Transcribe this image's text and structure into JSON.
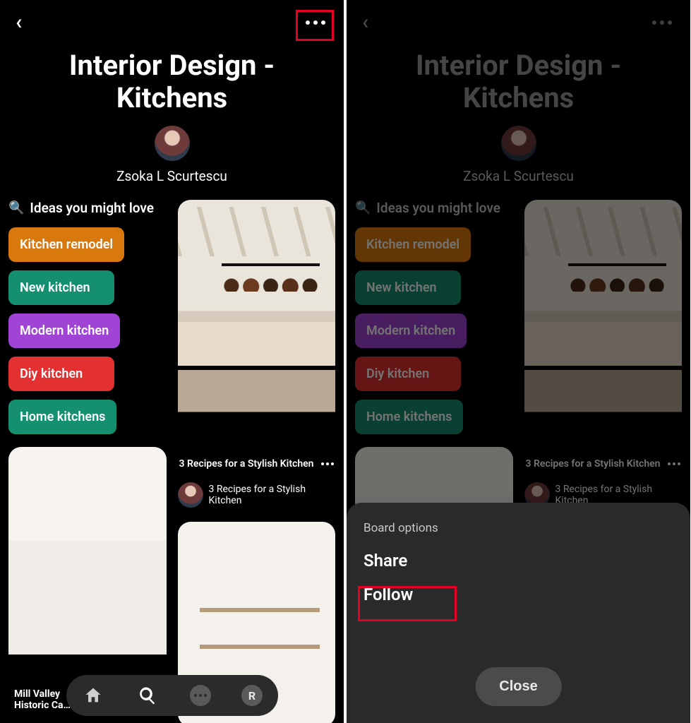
{
  "board": {
    "title": "Interior Design - Kitchens",
    "author": "Zsoka L Scurtescu"
  },
  "ideas": {
    "heading": "Ideas you might love",
    "chips": [
      {
        "label": "Kitchen remodel",
        "color": "#d9780d"
      },
      {
        "label": "New kitchen",
        "color": "#148f6f"
      },
      {
        "label": "Modern kitchen",
        "color": "#a044d6"
      },
      {
        "label": "Diy kitchen",
        "color": "#e33030"
      },
      {
        "label": "Home kitchens",
        "color": "#148f6f"
      }
    ]
  },
  "pins": {
    "p1": {
      "caption": "3 Recipes for a Stylish Kitchen",
      "desc": "3 Recipes for a Stylish Kitchen"
    },
    "p2": {
      "caption_line1": "Mill Valley",
      "caption_line2": "Historic Ca…"
    }
  },
  "sheet": {
    "label": "Board options",
    "option_share": "Share",
    "option_follow": "Follow",
    "close": "Close"
  },
  "nav": {
    "profile_initial": "R"
  }
}
